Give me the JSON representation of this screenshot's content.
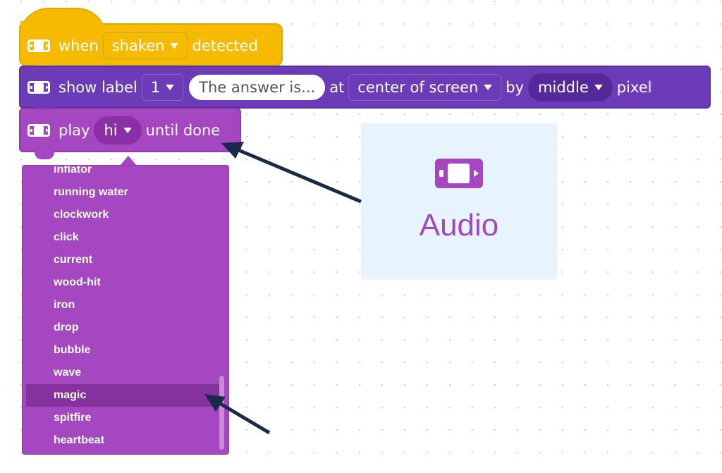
{
  "hat_block": {
    "when_label": "when",
    "event_value": "shaken",
    "detected_label": "detected"
  },
  "show_label_block": {
    "show_label_text": "show label",
    "label_number": "1",
    "text_value": "The answer is...",
    "at_label": "at",
    "position_value": "center of screen",
    "by_label": "by",
    "size_value": "middle",
    "pixel_label": "pixel"
  },
  "play_block": {
    "play_label": "play",
    "sound_value": "hi",
    "until_label": "until done"
  },
  "sound_menu": {
    "items": [
      "inflator",
      "running water",
      "clockwork",
      "click",
      "current",
      "wood-hit",
      "iron",
      "drop",
      "bubble",
      "wave",
      "magic",
      "spitfire",
      "heartbeat"
    ],
    "selected": "magic"
  },
  "audio_card": {
    "title": "Audio",
    "icon": "screen-device-icon"
  },
  "colors": {
    "event_yellow": "#f6bb00",
    "looks_purple": "#6b3bb8",
    "audio_purple": "#a547c0",
    "card_bg": "#e7f4fd",
    "arrow": "#1b2a4a"
  }
}
